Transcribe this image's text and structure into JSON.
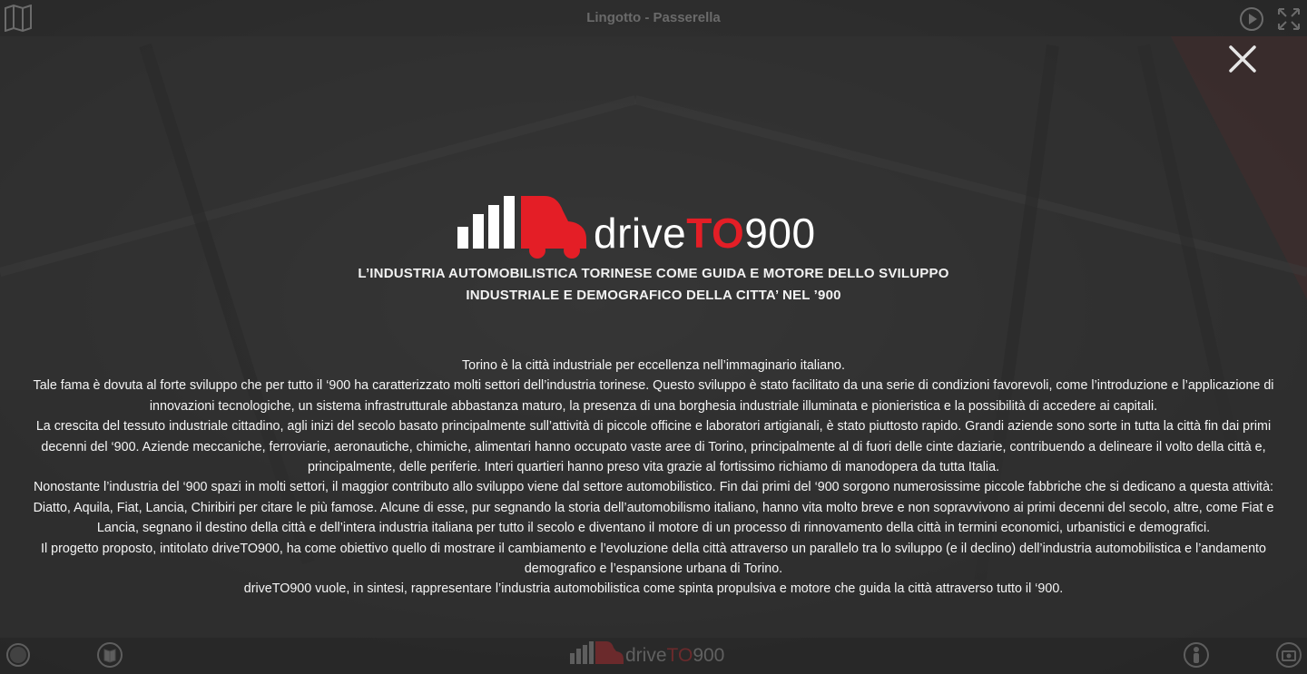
{
  "topbar": {
    "title": "Lingotto - Passerella",
    "left_icon": "map-icon",
    "right_icons": [
      "play-icon",
      "fullscreen-icon"
    ]
  },
  "modal": {
    "close_icon": "close-icon",
    "logo": {
      "text_prefix": "drive",
      "text_highlight": "TO",
      "text_suffix": "900"
    },
    "heading_line1": "L’INDUSTRIA AUTOMOBILISTICA TORINESE COME GUIDA E MOTORE DELLO SVILUPPO",
    "heading_line2": "INDUSTRIALE E DEMOGRAFICO DELLA CITTA’ NEL ’900",
    "paragraphs": [
      "Torino è la città industriale per eccellenza nell’immaginario italiano.",
      "Tale fama è dovuta al forte sviluppo che per tutto il ‘900 ha caratterizzato molti settori dell’industria torinese. Questo sviluppo è stato facilitato da una serie di condizioni favorevoli, come l’introduzione e l’applicazione di innovazioni tecnologiche, un sistema infrastrutturale abbastanza maturo, la presenza di una borghesia industriale illuminata e pionieristica e la possibilità di accedere ai capitali.",
      "La crescita del tessuto industriale cittadino, agli inizi del secolo basato principalmente sull’attività di piccole officine e laboratori artigianali, è stato piuttosto rapido. Grandi aziende sono sorte in tutta la città fin dai primi decenni del ‘900. Aziende meccaniche, ferroviarie, aeronautiche, chimiche, alimentari hanno occupato vaste aree di Torino, principalmente al di fuori delle cinte daziarie, contribuendo a delineare il volto della città e, principalmente, delle periferie. Interi quartieri hanno preso vita grazie al fortissimo richiamo di manodopera da tutta Italia.",
      "Nonostante l’industria del ‘900 spazi in molti settori, il maggior contributo allo sviluppo viene dal settore automobilistico. Fin dai primi del ‘900 sorgono numerosissime piccole fabbriche che si dedicano a questa attività: Diatto, Aquila, Fiat, Lancia, Chiribiri per citare le più famose. Alcune di esse, pur segnando la storia dell’automobilismo italiano, hanno vita molto breve e non sopravvivono ai primi decenni del secolo, altre, come Fiat e Lancia, segnano il destino della città e dell’intera industria italiana per tutto il secolo e diventano il motore di un processo di rinnovamento della città in termini economici, urbanistici e demografici.",
      "Il progetto proposto, intitolato driveTO900, ha come obiettivo quello di mostrare il cambiamento e l’evoluzione della città attraverso un parallelo tra lo sviluppo (e il declino) dell’industria automobilistica e l’andamento demografico e l’espansione urbana di Torino.",
      "driveTO900 vuole, in sintesi, rappresentare l’industria automobilistica come spinta propulsiva e motore che guida la città attraverso tutto il ‘900."
    ]
  },
  "bottombar": {
    "left_icons": [
      "cc-by-icon",
      "book-icon"
    ],
    "logo": {
      "text_prefix": "drive",
      "text_highlight": "TO",
      "text_suffix": "900"
    },
    "right_icons": [
      "person-icon",
      "camera-icon"
    ]
  },
  "colors": {
    "accent_red": "#e41e26",
    "overlay": "#2a2a2a",
    "text": "#f5f5f5"
  }
}
